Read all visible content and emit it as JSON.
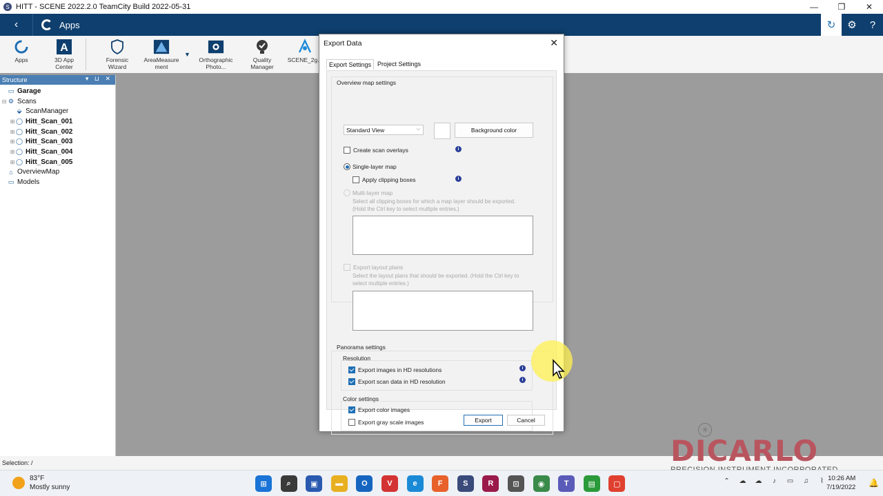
{
  "window": {
    "title": "HITT - SCENE 2022.2.0 TeamCity Build 2022-05-31",
    "app_icon": "S"
  },
  "window_controls": {
    "minimize": "—",
    "restore": "❐",
    "close": "✕"
  },
  "appbar": {
    "back_glyph": "‹",
    "label": "Apps",
    "settings_glyph": "⚙",
    "help_glyph": "?",
    "sync_glyph": "↻"
  },
  "ribbon": {
    "items": [
      {
        "label": "Apps",
        "icon": "apps-icon"
      },
      {
        "label": "3D App\nCenter",
        "icon": "app-center-icon"
      },
      {
        "label": "Forensic\nWizard",
        "icon": "shield-icon"
      },
      {
        "label": "AreaMeasure\nment",
        "icon": "area-measurement-icon"
      },
      {
        "label": "Orthographic\nPhoto...",
        "icon": "camera-icon"
      },
      {
        "label": "Quality\nManager",
        "icon": "quality-icon"
      },
      {
        "label": "SCENE_2g...",
        "icon": "scene-icon"
      }
    ],
    "dropdown_glyph": "▼"
  },
  "structure": {
    "header": "Structure",
    "controls": "▾ ⊔ ✕",
    "tree": [
      {
        "label": "Garage",
        "bold": true,
        "exp": "",
        "icon": "folder-icon"
      },
      {
        "label": "Scans",
        "bold": false,
        "exp": "⊟",
        "icon": "scans-icon"
      },
      {
        "label": "ScanManager",
        "bold": false,
        "exp": "",
        "icon": "scan-manager-icon"
      },
      {
        "label": "Hitt_Scan_001",
        "bold": true,
        "exp": "⊞",
        "icon": "scan-icon"
      },
      {
        "label": "Hitt_Scan_002",
        "bold": true,
        "exp": "⊞",
        "icon": "scan-icon"
      },
      {
        "label": "Hitt_Scan_003",
        "bold": true,
        "exp": "⊞",
        "icon": "scan-icon"
      },
      {
        "label": "Hitt_Scan_004",
        "bold": true,
        "exp": "⊞",
        "icon": "scan-icon"
      },
      {
        "label": "Hitt_Scan_005",
        "bold": true,
        "exp": "⊞",
        "icon": "scan-icon"
      },
      {
        "label": "OverviewMap",
        "bold": false,
        "exp": "",
        "icon": "overview-map-icon"
      },
      {
        "label": "Models",
        "bold": false,
        "exp": "",
        "icon": "folder-icon"
      }
    ]
  },
  "status": {
    "selection": "Selection: /"
  },
  "dialog": {
    "title": "Export Data",
    "close_glyph": "✕",
    "tabs": [
      {
        "label": "Export Settings",
        "active": true
      },
      {
        "label": "Project Settings",
        "active": false
      }
    ],
    "overview": {
      "group_label": "Overview map settings",
      "view_select": "Standard View",
      "select_arrow": "⌵",
      "background_button": "Background color",
      "create_overlays": "Create scan overlays",
      "single_layer": "Single-layer map",
      "apply_clipping": "Apply clipping boxes",
      "multi_layer": "Multi-layer map",
      "multi_hint": "Select all clipping boxes for which a map layer should be exported. (Hold the Ctrl key to select multiple entries.)",
      "export_layout": "Export layout plans",
      "layout_hint": "Select the layout plans that should be exported. (Hold the Ctrl key to select multiple entries.)"
    },
    "panorama": {
      "group_label": "Panorama settings",
      "resolution_label": "Resolution",
      "hd_images": "Export images in HD resolutions",
      "hd_scan": "Export scan data in HD resolution",
      "color_label": "Color settings",
      "color_images": "Export color images",
      "gray_images": "Export gray scale images"
    },
    "info_glyph": "i",
    "export_button": "Export",
    "cancel_button": "Cancel"
  },
  "watermark": {
    "name": "DICARLO",
    "sub": "PRECISION INSTRUMENT INCORPORATED",
    "star": "✳"
  },
  "taskbar": {
    "weather_temp": "83°F",
    "weather_desc": "Mostly sunny",
    "apps": [
      {
        "icon": "windows-start-icon",
        "glyph": "⊞",
        "color": "#1a73d6"
      },
      {
        "icon": "search-icon",
        "glyph": "⌕",
        "color": "#3a3a3a"
      },
      {
        "icon": "save-app-icon",
        "glyph": "▣",
        "color": "#2a5ab0"
      },
      {
        "icon": "file-explorer-icon",
        "glyph": "▬",
        "color": "#e8b020"
      },
      {
        "icon": "outlook-icon",
        "glyph": "O",
        "color": "#1565c0"
      },
      {
        "icon": "vivaldi-icon",
        "glyph": "V",
        "color": "#d43333"
      },
      {
        "icon": "edge-icon",
        "glyph": "e",
        "color": "#1b8ad6"
      },
      {
        "icon": "firefox-icon",
        "glyph": "F",
        "color": "#e8602a"
      },
      {
        "icon": "scene-taskbar-icon",
        "glyph": "S",
        "color": "#3a4a7a"
      },
      {
        "icon": "recap-icon",
        "glyph": "R",
        "color": "#9a1a4a"
      },
      {
        "icon": "remote-icon",
        "glyph": "⊡",
        "color": "#555555"
      },
      {
        "icon": "globe-app-icon",
        "glyph": "◉",
        "color": "#3a8a4a"
      },
      {
        "icon": "teams-icon",
        "glyph": "T",
        "color": "#5a5ab8"
      },
      {
        "icon": "sketchup-icon",
        "glyph": "▤",
        "color": "#2a9a3a"
      },
      {
        "icon": "red-app-icon",
        "glyph": "▢",
        "color": "#e04030"
      }
    ],
    "tray": [
      {
        "icon": "chevron-up-icon",
        "glyph": "⌃"
      },
      {
        "icon": "cloud-icon",
        "glyph": "☁"
      },
      {
        "icon": "cloud-outline-icon",
        "glyph": "☁"
      },
      {
        "icon": "mic-icon",
        "glyph": "♪"
      },
      {
        "icon": "display-icon",
        "glyph": "▭"
      },
      {
        "icon": "speaker-icon",
        "glyph": "♫"
      },
      {
        "icon": "network-icon",
        "glyph": "⌇"
      }
    ],
    "time": "10:26 AM",
    "date": "7/19/2022",
    "bell_glyph": "🔔"
  }
}
